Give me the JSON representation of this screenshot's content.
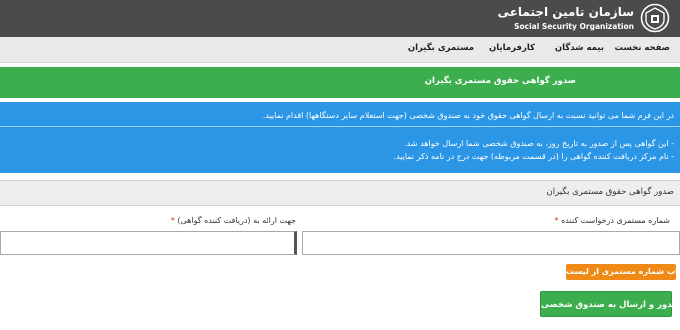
{
  "header": {
    "org_name_fa": "سازمان تامین اجتماعی",
    "org_name_en": "Social Security Organization"
  },
  "nav": {
    "items": [
      {
        "label": "صفحه نخست"
      },
      {
        "label": "بیمه شدگان"
      },
      {
        "label": "کارفرمایان"
      },
      {
        "label": "مستمری بگیران"
      }
    ]
  },
  "banner": {
    "title": "صدور گواهی حقوق مستمری بگیران"
  },
  "info": {
    "intro": "در این فرم شما می توانید نسبت به ارسال گواهی حقوق خود به صندوق شخصی (جهت استعلام سایر دستگاهها) اقدام نمایید.",
    "notes": [
      "- این گواهی پس از صدور به تاریخ روز، به صندوق شخصی شما ارسال خواهد شد.",
      "- نام مرکز دریافت کننده گواهی را (در قسمت مربوطه) جهت درج در نامه ذکر نمایید."
    ]
  },
  "form": {
    "panel_title": "صدور گواهی حقوق مستمری بگیران",
    "request_number_label": "شماره مستمری درخواست کننده",
    "recipient_label": "جهت ارائه به (دریافت کننده گواهی)",
    "required_mark": "*",
    "select_button_label": "انتخاب شماره مستمری از لیست",
    "submit_button_label": "صدور و ارسال به صندوق شخصی"
  },
  "colors": {
    "header_bg": "#4b4b4b",
    "banner_green": "#3cae4e",
    "info_blue": "#2b96e6",
    "button_orange": "#f08a17"
  }
}
